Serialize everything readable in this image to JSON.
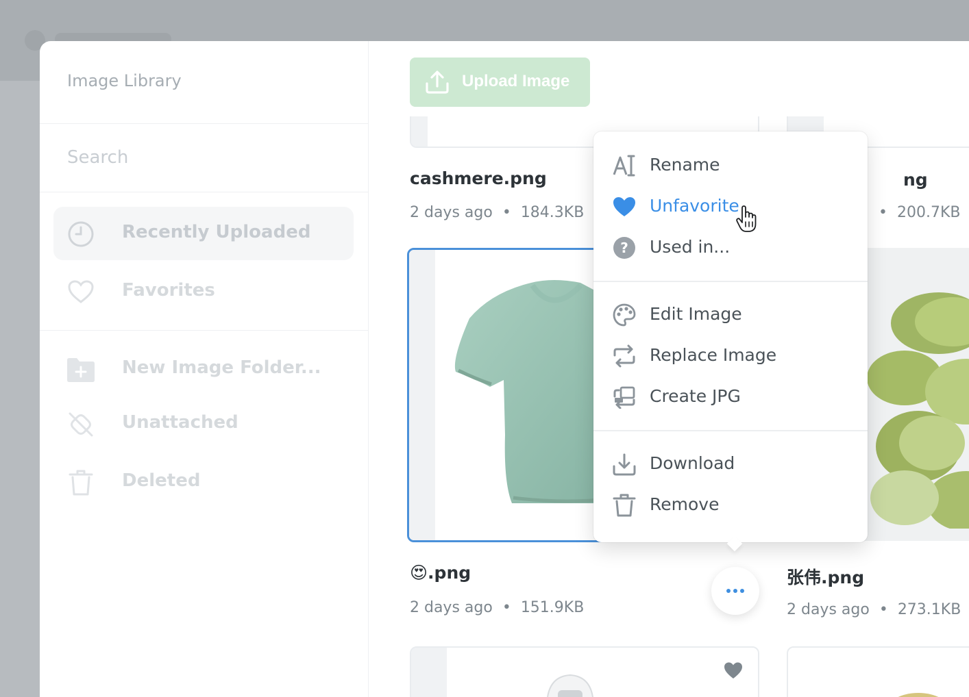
{
  "sidebar": {
    "title": "Image Library",
    "search_placeholder": "Search",
    "items": [
      {
        "label": "Recently Uploaded",
        "icon": "clock-icon",
        "active": true
      },
      {
        "label": "Favorites",
        "icon": "heart-outline-icon"
      },
      {
        "label": "New Image Folder...",
        "icon": "folder-plus-icon"
      },
      {
        "label": "Unattached",
        "icon": "unlink-icon"
      },
      {
        "label": "Deleted",
        "icon": "trash-icon"
      }
    ]
  },
  "toolbar": {
    "upload_label": "Upload Image",
    "upload_icon": "upload-icon"
  },
  "files": [
    {
      "name": "cashmere.png",
      "time": "2 days ago",
      "size": "184.3KB"
    },
    {
      "name": "ng",
      "time": "",
      "size": "200.7KB"
    },
    {
      "name": "😍.png",
      "time": "2 days ago",
      "size": "151.9KB"
    },
    {
      "name": "张伟.png",
      "time": "2 days ago",
      "size": "273.1KB"
    }
  ],
  "meta_separator": "•",
  "context_menu": {
    "groups": [
      [
        {
          "label": "Rename",
          "icon": "rename-text-icon"
        },
        {
          "label": "Unfavorite",
          "icon": "heart-filled-icon",
          "highlighted": true
        },
        {
          "label": "Used in...",
          "icon": "question-circle-icon"
        }
      ],
      [
        {
          "label": "Edit Image",
          "icon": "palette-icon"
        },
        {
          "label": "Replace Image",
          "icon": "replace-arrows-icon"
        },
        {
          "label": "Create JPG",
          "icon": "convert-image-icon"
        }
      ],
      [
        {
          "label": "Download",
          "icon": "download-icon"
        },
        {
          "label": "Remove",
          "icon": "trash-icon"
        }
      ]
    ]
  },
  "colors": {
    "accent": "#3a8ee6",
    "upload_button": "#cde9d2",
    "selected_border": "#4a90d9",
    "text_dark": "#2d3338",
    "text_muted": "#7d868d"
  }
}
